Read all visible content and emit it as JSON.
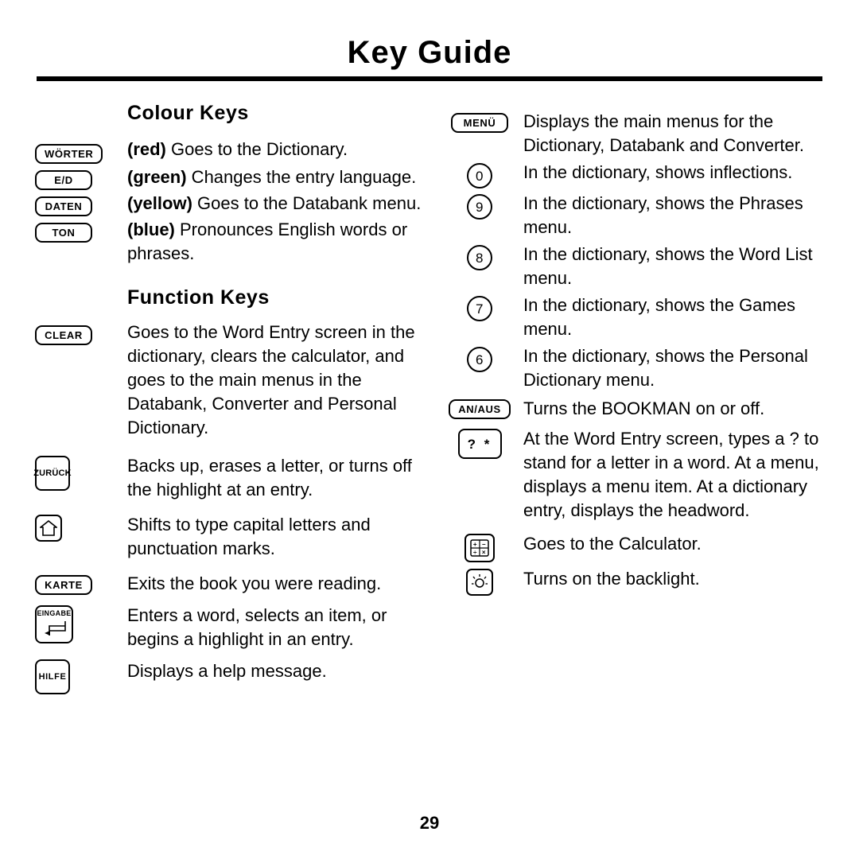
{
  "page": {
    "title": "Key Guide",
    "number": "29"
  },
  "sections": {
    "colour_keys": {
      "heading": "Colour Keys",
      "rows": [
        {
          "key": "WÖRTER",
          "key_icon": "key-woerter",
          "bold": "(red)",
          "text": " Goes to the Dictionary."
        },
        {
          "key": "E/D",
          "key_icon": "key-e-d",
          "bold": "(green)",
          "text": " Changes the entry language."
        },
        {
          "key": "DATEN",
          "key_icon": "key-daten",
          "bold": "(yellow)",
          "text": " Goes to the Databank menu."
        },
        {
          "key": "TON",
          "key_icon": "key-ton",
          "bold": "(blue)",
          "text": " Pronounces English words or phrases."
        }
      ]
    },
    "function_keys": {
      "heading": "Function Keys",
      "rows": [
        {
          "key": "CLEAR",
          "key_icon": "key-clear",
          "text": "Goes to the Word Entry screen in the dictionary, clears the calculator, and goes to the main menus in the Databank, Converter and Personal Dictionary."
        },
        {
          "key": "ZURÜCK",
          "key_icon": "key-zurueck",
          "text": "Backs up, erases a letter, or turns off the highlight at an entry."
        },
        {
          "key": "",
          "key_icon": "key-shift-up-arrow",
          "text": "Shifts to type capital letters and punctuation marks."
        },
        {
          "key": "KARTE",
          "key_icon": "key-karte",
          "text": "Exits the book you were reading."
        },
        {
          "key": "EINGABE",
          "key_icon": "key-eingabe",
          "text": "Enters a word, selects an item, or begins a highlight in an entry."
        },
        {
          "key": "HILFE",
          "key_icon": "key-hilfe",
          "text": "Displays a help message."
        }
      ]
    },
    "right_column": {
      "rows": [
        {
          "key": "MENÜ",
          "key_icon": "key-menue",
          "text": "Displays the main menus for the Dictionary, Databank and Converter."
        },
        {
          "key": "0",
          "key_icon": "key-0",
          "text": "In the dictionary, shows inflections."
        },
        {
          "key": "9",
          "key_icon": "key-9",
          "text": "In the dictionary, shows the Phrases menu."
        },
        {
          "key": "8",
          "key_icon": "key-8",
          "text": "In the dictionary, shows the Word List menu."
        },
        {
          "key": "7",
          "key_icon": "key-7",
          "text": "In the dictionary, shows the Games menu."
        },
        {
          "key": "6",
          "key_icon": "key-6",
          "text": "In the dictionary, shows the Personal Dictionary menu."
        },
        {
          "key": "AN/AUS",
          "key_icon": "key-an-aus",
          "text": "Turns the BOOKMAN on or off."
        },
        {
          "key": "? *",
          "key_icon": "key-question-star",
          "text": "At the Word Entry screen, types a ? to stand for a letter in a word. At a menu, displays a menu item. At a dictionary entry, displays the headword."
        },
        {
          "key": "",
          "key_icon": "key-calculator",
          "text": "Goes to the Calculator."
        },
        {
          "key": "",
          "key_icon": "key-backlight",
          "text": "Turns on the backlight."
        }
      ]
    }
  }
}
